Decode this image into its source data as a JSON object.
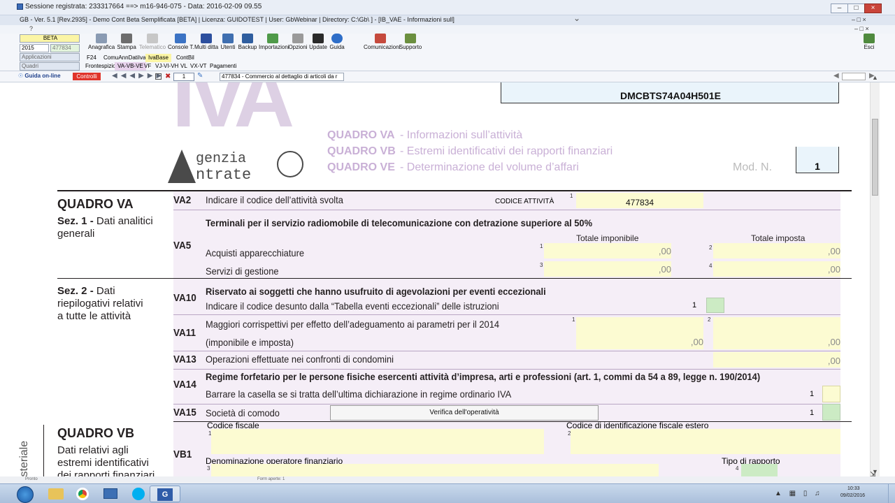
{
  "window": {
    "session_title": "Sessione registrata: 233317664 ==> m16-946-075 - Data: 2016-02-09 09.55",
    "app_title": "GB - Ver. 5.1 [Rev.2935] -  Demo Cont Beta Semplificata [BETA]     | Licenza: GUIDOTEST | User: GbWebinar | Directory: C:\\Gb\\ ] - [IB_VAE - Informazioni sull]",
    "menu_help": "?"
  },
  "toolbar": {
    "company": "BETA",
    "year": "2015",
    "activity_code": "477834",
    "menu_applicazioni": "Applicazioni",
    "menu_quadri": "Quadri",
    "buttons": [
      "Anagrafica",
      "Stampa",
      "Telematico",
      "Console T.",
      "Multi ditta",
      "Utenti",
      "Backup",
      "Importazioni",
      "Opzioni",
      "Update",
      "Guida",
      "Comunicazioni",
      "Supporto"
    ],
    "exit_label": "Esci",
    "tabs_row1": [
      "F24",
      "ComuAnnDatiIva",
      "IvaBase",
      "ContBil"
    ],
    "tabs_row2": [
      "Frontespizio",
      "VA-VB-VE",
      "VF",
      "VJ-VI-VH",
      "VL",
      "VX-VT",
      "Pagamenti"
    ]
  },
  "nav": {
    "guide_online": "Guida on-line",
    "controlli": "Controlli",
    "page_number": "1",
    "activity_select": "477834 - Commercio al dettaglio di articoli da r"
  },
  "form": {
    "codice_fiscale": "DMCBTS74A04H501E",
    "logo_iva": "IVA",
    "logo_agenzia_1": "genzia",
    "logo_agenzia_2": "ntrate",
    "header": [
      {
        "quadro": "QUADRO VA",
        "desc": "- Informazioni sull’attività"
      },
      {
        "quadro": "QUADRO VB",
        "desc": "- Estremi identificativi dei rapporti finanziari"
      },
      {
        "quadro": "QUADRO VE",
        "desc": "- Determinazione del volume d’affari"
      }
    ],
    "mod_n_label": "Mod. N.",
    "mod_n_value": "1",
    "quadro_va": {
      "title": "QUADRO VA",
      "sez1_a": "Sez. 1 -",
      "sez1_b": "Dati analitici",
      "sez1_c": "generali",
      "sez2_a": "Sez. 2 -",
      "sez2_b": "Dati",
      "sez2_c": "riepilogativi relativi",
      "sez2_d": "a tutte le attività"
    },
    "va2": {
      "code": "VA2",
      "text": "Indicare il codice dell’attività svolta",
      "field_label": "CODICE ATTIVITÀ",
      "sup": "1",
      "value": "477834"
    },
    "va5": {
      "code": "VA5",
      "title": "Terminali per il servizio radiomobile di telecomunicazione con detrazione superiore al 50%",
      "col1": "Totale imponibile",
      "col2": "Totale imposta",
      "row1": "Acquisti apparecchiature",
      "row2": "Servizi di gestione",
      "sup1": "1",
      "sup2": "2",
      "sup3": "3",
      "sup4": "4",
      "cents": ",00"
    },
    "va10": {
      "code": "VA10",
      "title": "Riservato ai soggetti che hanno usufruito di agevolazioni per eventi eccezionali",
      "text": "Indicare il codice desunto dalla “Tabella eventi eccezionali” delle istruzioni",
      "num": "1"
    },
    "va11": {
      "code": "VA11",
      "line1": "Maggiori corrispettivi per effetto dell’adeguamento ai parametri per il 2014",
      "line2": "(imponibile e imposta)",
      "sup1": "1",
      "sup2": "2",
      "cents": ",00"
    },
    "va13": {
      "code": "VA13",
      "text": "Operazioni effettuate nei confronti di condomini",
      "cents": ",00"
    },
    "va14": {
      "code": "VA14",
      "title": "Regime forfetario per le persone fisiche esercenti attività d’impresa, arti e professioni (art. 1, commi da 54 a 89, legge n. 190/2014)",
      "text": "Barrare la casella se si tratta dell’ultima dichiarazione in regime ordinario IVA",
      "num": "1"
    },
    "va15": {
      "code": "VA15",
      "text": "Società di comodo",
      "button": "Verifica dell'operatività",
      "num": "1"
    },
    "quadro_vb": {
      "side_text": "isteriale",
      "title": "QUADRO VB",
      "desc1": "Dati relativi agli",
      "desc2": "estremi identificativi",
      "desc3": "dei rapporti finanziari"
    },
    "vb1": {
      "code": "VB1",
      "cf_label": "Codice fiscale",
      "cf_estero_label": "Codice di identificazione fiscale estero",
      "denominazione_label": "Denominazione operatore finanziario",
      "tipo_label": "Tipo di rapporto",
      "sup1": "1",
      "sup2": "2",
      "sup3": "3",
      "sup4": "4"
    }
  },
  "status": {
    "left": "Pronto",
    "forms_open": "Form aperte: 1"
  },
  "taskbar": {
    "time": "10:33",
    "date": "09/02/2016"
  }
}
